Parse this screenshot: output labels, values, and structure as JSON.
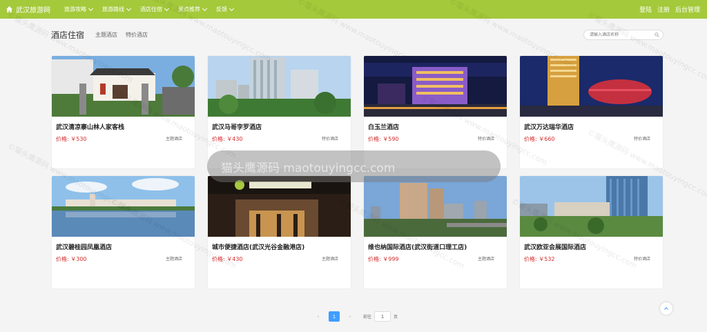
{
  "nav": {
    "brand": "武汉旅游网",
    "items": [
      "旅游攻略",
      "旅游路线",
      "酒店住宿",
      "景点推荐",
      "反馈"
    ],
    "right": [
      "登陆",
      "注册",
      "后台管理"
    ]
  },
  "header": {
    "title": "酒店住宿",
    "tabs": [
      "主题酒店",
      "特价酒店"
    ],
    "search_placeholder": "请输入酒店名称"
  },
  "price_prefix": "价格: ￥",
  "hotels": [
    {
      "name": "武汉清凉寨山林人家客栈",
      "price": "价格: ￥530",
      "tag": "主题酒店"
    },
    {
      "name": "武汉马哥孛罗酒店",
      "price": "价格: ￥430",
      "tag": "特价酒店"
    },
    {
      "name": "白玉兰酒店",
      "price": "价格: ￥590",
      "tag": "特价酒店"
    },
    {
      "name": "武汉万达瑞华酒店",
      "price": "价格: ￥660",
      "tag": "特价酒店"
    },
    {
      "name": "武汉碧桂园凤凰酒店",
      "price": "价格: ￥300",
      "tag": "主题酒店"
    },
    {
      "name": "城市便捷酒店(武汉光谷金融港店)",
      "price": "价格: ￥430",
      "tag": "主题酒店"
    },
    {
      "name": "维也纳国际酒店(武汉街道口理工店)",
      "price": "价格: ￥999",
      "tag": "主题酒店"
    },
    {
      "name": "武汉欧亚会展国际酒店",
      "price": "价格: ￥532",
      "tag": "特价酒店"
    }
  ],
  "pagination": {
    "current": "1",
    "goto_label": "前往",
    "goto_value": "1",
    "page_label": "页"
  },
  "watermark": {
    "banner": "猫头鹰源码 maotouyingcc.com",
    "text": "©猫头鹰源码 www.maotouyingcc.com"
  },
  "colors": {
    "nav_bg": "#a4c93a",
    "price": "#d62a2a",
    "accent": "#409eff"
  },
  "icons": {
    "home": "home-icon",
    "dropdown": "chevron-down-icon",
    "search": "search-icon",
    "back_to_top": "chevron-up-icon"
  }
}
